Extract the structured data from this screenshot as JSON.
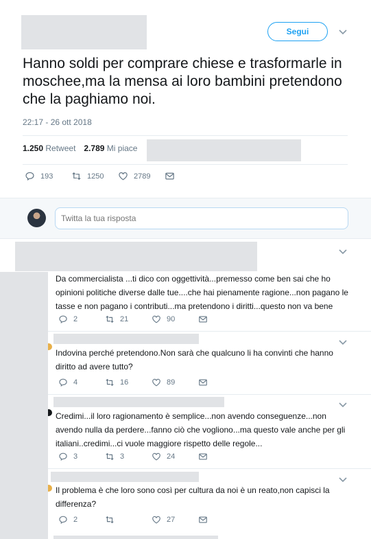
{
  "main_tweet": {
    "follow_label": "Segui",
    "text": "Hanno soldi per comprare chiese e trasformarle in moschee,ma la mensa ai loro bambini pretendono che la paghiamo noi.",
    "timestamp": "22:17 - 26 ott 2018",
    "retweets_count": "1.250",
    "retweets_label": "Retweet",
    "likes_count": "2.789",
    "likes_label": "Mi piace",
    "replies": "193",
    "retweets": "1250",
    "likes": "2789"
  },
  "composer": {
    "placeholder": "Twitta la tua risposta"
  },
  "replies": [
    {
      "text": "Da commercialista ...ti dico con oggettività...premesso come ben sai che ho opinioni politiche diverse dalle tue....che hai pienamente ragione...non pagano le tasse e non pagano i contributi...ma pretendono i diritti...questo non va bene",
      "replies": "2",
      "retweets": "21",
      "likes": "90"
    },
    {
      "text": "Indovina perché pretendono.Non sarà che qualcuno li ha convinti che hanno diritto ad avere tutto?",
      "replies": "4",
      "retweets": "16",
      "likes": "89"
    },
    {
      "text": "Credimi...il loro ragionamento è semplice...non avendo conseguenze...non avendo nulla da perdere...fanno ciò che vogliono...ma questo vale anche per gli italiani..credimi...ci vuole maggiore rispetto delle regole...",
      "replies": "3",
      "retweets": "3",
      "likes": "24"
    },
    {
      "text": "Il problema è che loro sono così per cultura da noi è un reato,non capisci la differenza?",
      "replies": "2",
      "retweets": "",
      "likes": "27"
    }
  ],
  "colors": {
    "accent": "#1da1f2",
    "muted_text": "#657786",
    "redaction": "#e1e3e6"
  }
}
